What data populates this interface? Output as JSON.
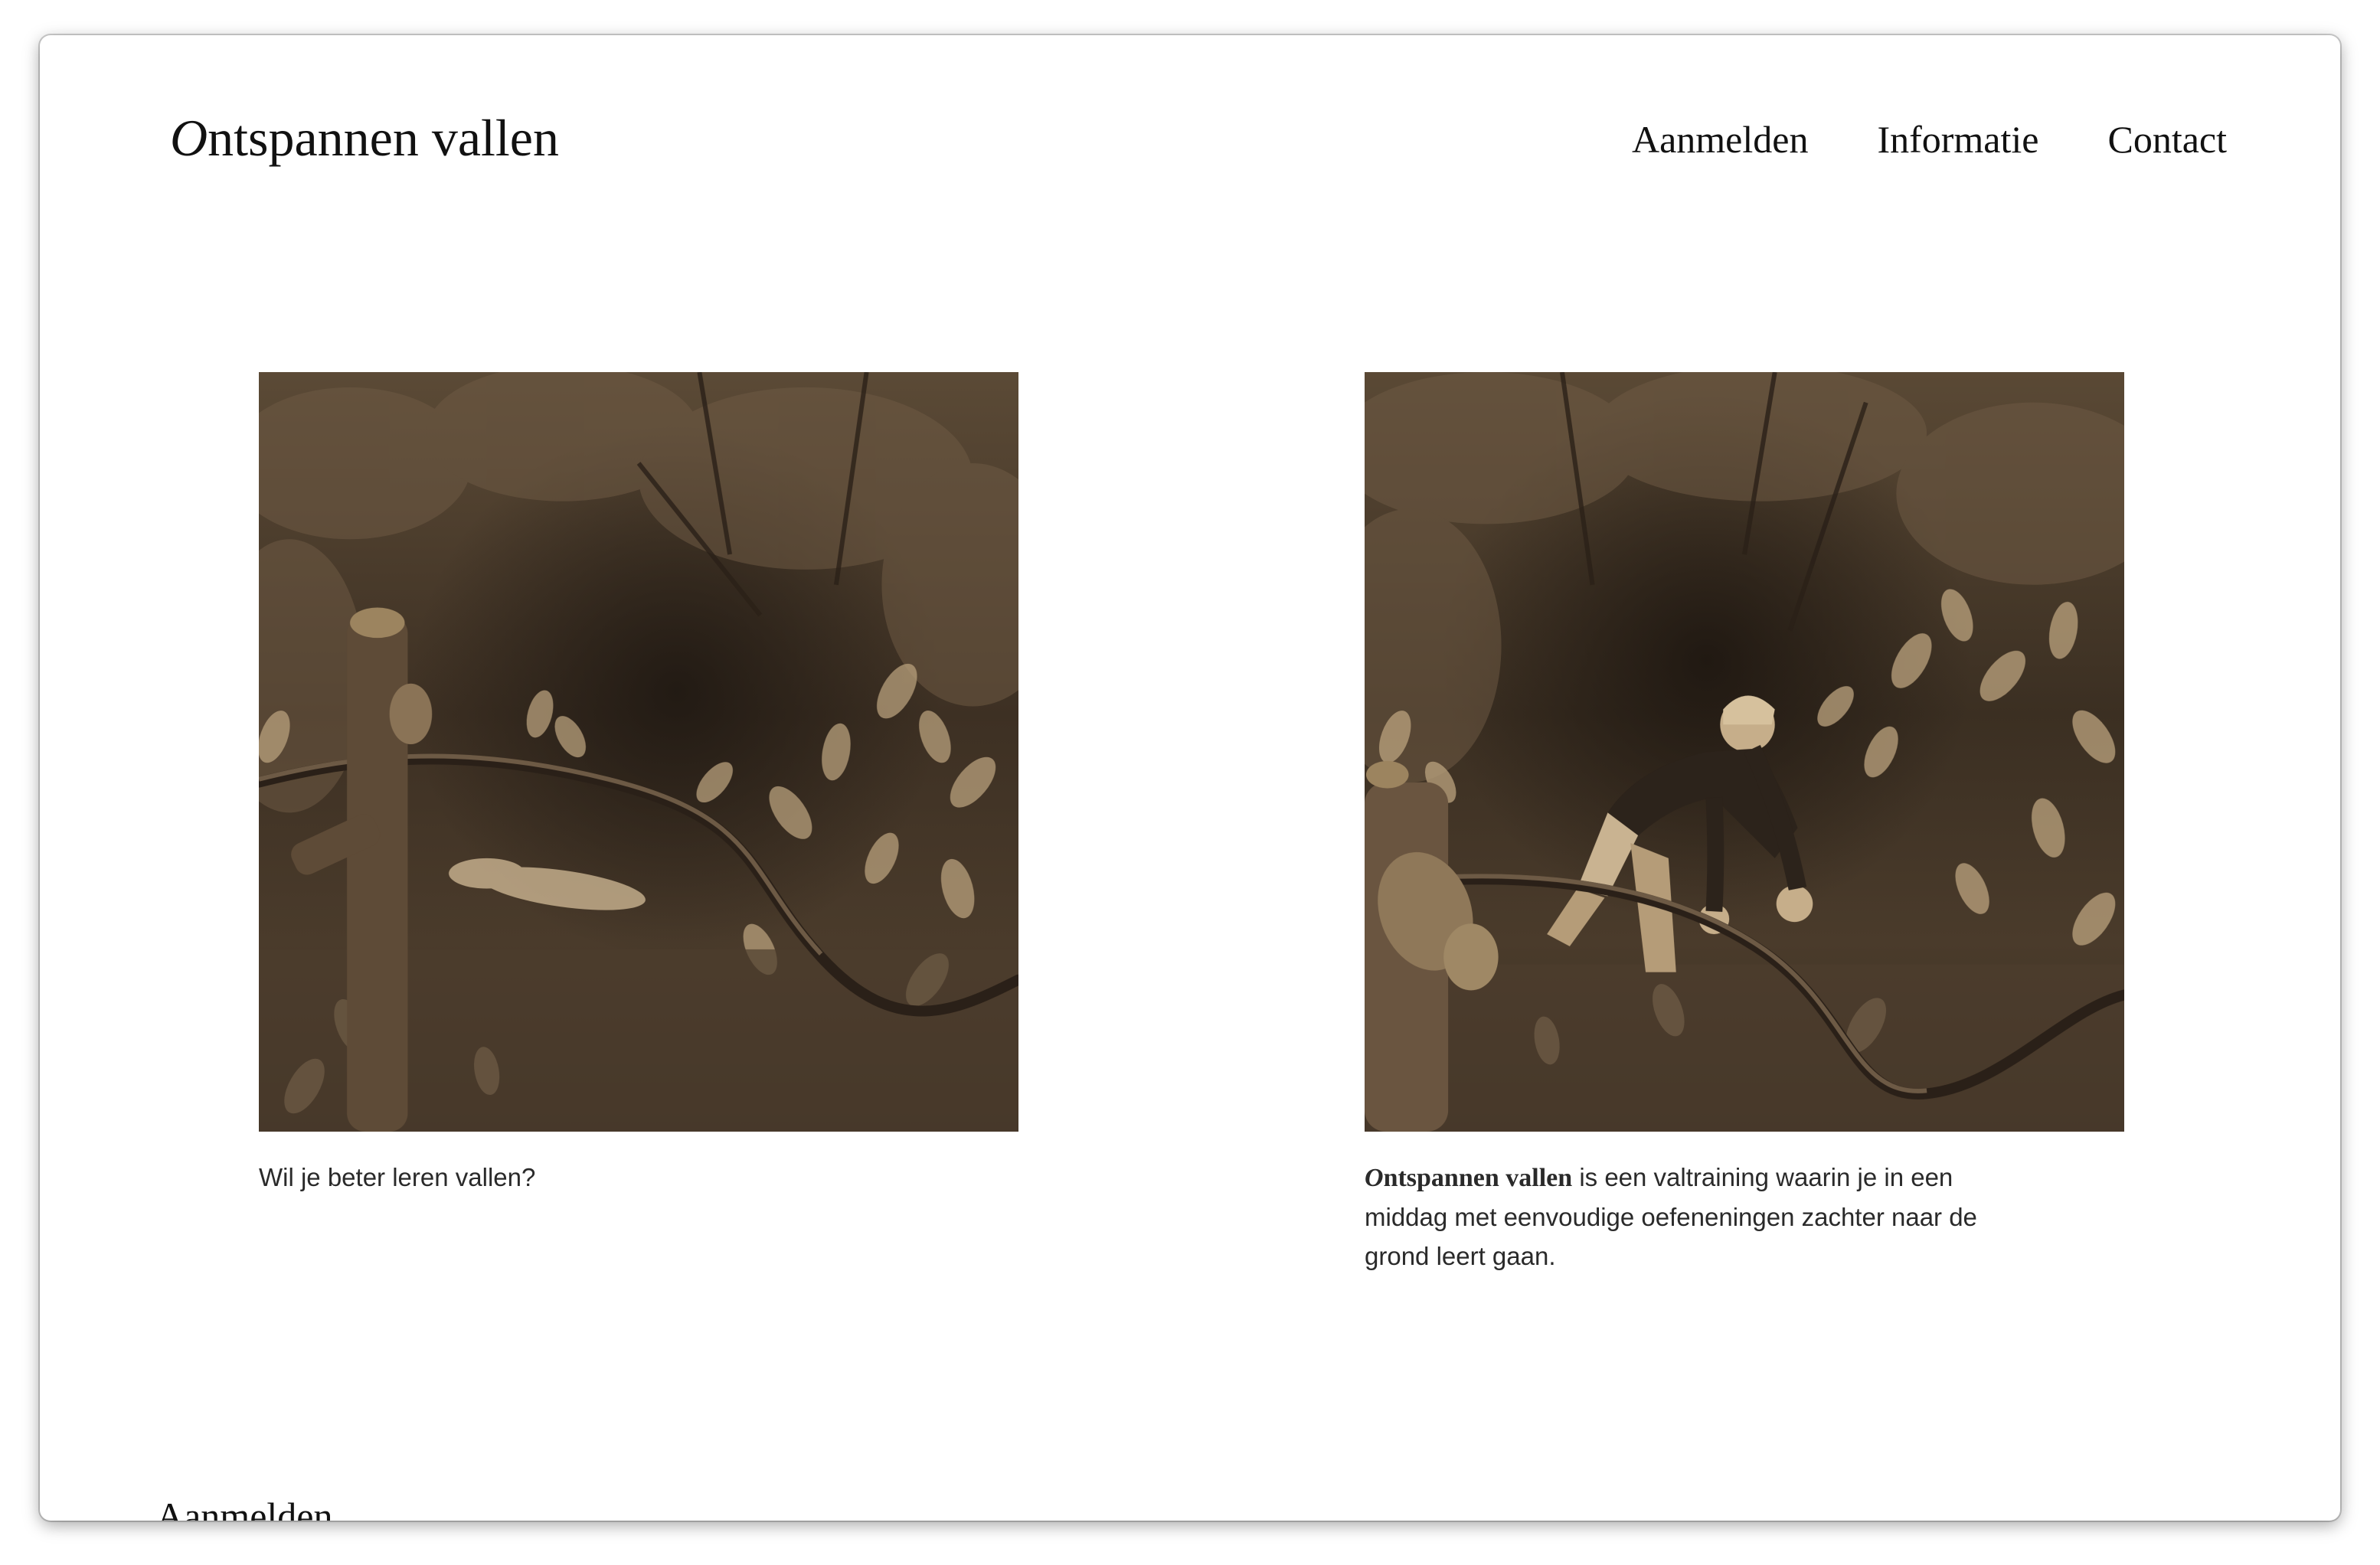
{
  "header": {
    "logo_first_letter": "O",
    "logo_rest": "ntspannen vallen",
    "nav": [
      {
        "label": "Aanmelden"
      },
      {
        "label": "Informatie"
      },
      {
        "label": "Contact"
      }
    ]
  },
  "main": {
    "cards": [
      {
        "photo_icon": "forest-photo-person-lying",
        "caption": "Wil je beter leren vallen?"
      },
      {
        "photo_icon": "forest-photo-person-falling",
        "caption_brand_first_letter": "O",
        "caption_brand_rest": "ntspannen vallen",
        "caption_rest": " is een valtraining waarin je in een middag met eenvoudige oefeneningen zachter naar de grond leert gaan."
      }
    ]
  },
  "sections": {
    "next_heading": "Aanmelden"
  },
  "colors": {
    "sepia_dark": "#3b2e22",
    "sepia_mid": "#6e5a44",
    "sepia_light": "#b9a07c",
    "text": "#111111"
  }
}
